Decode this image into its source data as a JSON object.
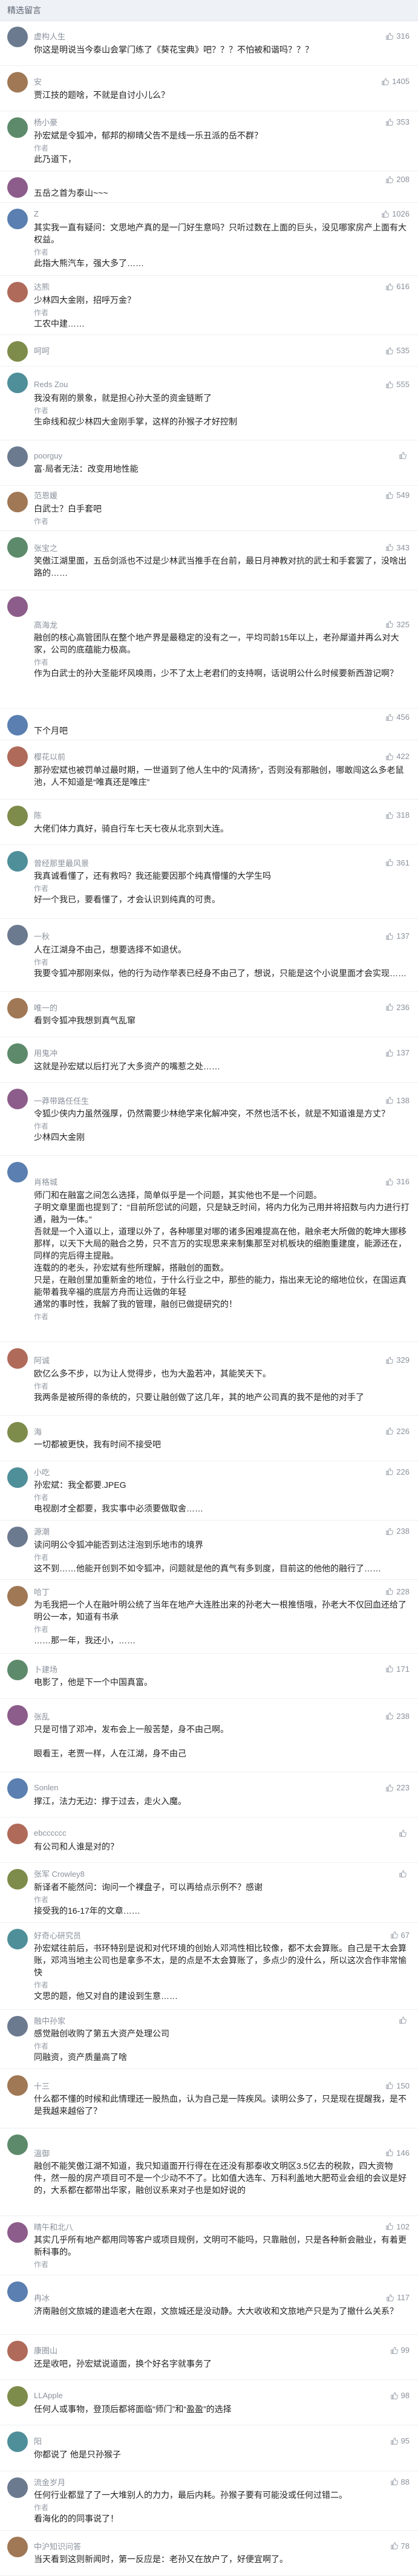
{
  "header": {
    "title": "精选留言"
  },
  "icons": {
    "like": "thumb-up-icon",
    "avatar": "user-avatar"
  },
  "colors": {
    "meta": "#8a919c",
    "section_bg": "#eef1f5",
    "divider": "#eceff2"
  },
  "comments": [
    {
      "author": "虚构人生",
      "likes": "316",
      "body": "你这是明说当今泰山会掌门练了《葵花宝典》吧？？？不怕被和谐吗？？？",
      "reply": null,
      "w": "w2"
    },
    {
      "author": "安",
      "likes": "1405",
      "body": "贾江技的题啥，不就是自讨小儿么？",
      "reply": null,
      "w": "w2"
    },
    {
      "author": "杨小豪",
      "likes": "353",
      "body": "孙宏斌是令狐冲，郁邦的柳晴父告不是线一乐丑派的岳不群？",
      "reply": "此乃道下，",
      "w": "w3"
    },
    {
      "author": "",
      "likes": "208",
      "body": "五岳之首为泰山~~~",
      "reply": null,
      "w": "w1"
    },
    {
      "author": "Z",
      "likes": "1026",
      "body": "其实我一直有疑问：文思地产真的是一门好生意吗？只听过数在上面的巨头，没见哪家房产上面有大权益。",
      "reply": "此指大熊汽车，强大多了……",
      "w": "w4"
    },
    {
      "author": "达熊",
      "likes": "616",
      "body": "少林四大金刚，招呼万金？",
      "reply": "工农中建……",
      "w": "w3"
    },
    {
      "author": "呵呵",
      "likes": "535",
      "body": "",
      "reply": null,
      "w": "w1"
    },
    {
      "author": "Reds Zou",
      "likes": "555",
      "body": "我没有刚的景象，就是担心孙大圣的资金链断了",
      "reply": "生命线和叔少林四大金刚手掌，这样的孙猴子才好控制",
      "w": "w4"
    },
    {
      "author": "poorguy",
      "likes": "",
      "body": "富·局者无法：改变用地性能",
      "reply": null,
      "w": "w2"
    },
    {
      "author": "范恩媛",
      "likes": "549",
      "body": "白武士？白手套吧",
      "reply": "",
      "w": "w2"
    },
    {
      "author": "张宝之",
      "likes": "343",
      "body": "笑傲江湖里面，五岳剑派也不过是少林武当推手在台前，最日月神教对抗的武士和手套罢了，没啥出路的……",
      "reply": null,
      "w": "w3"
    },
    {
      "author": "高海龙",
      "likes": "325",
      "body": "融创的核心高管团队在整个地产界是最稳定的没有之一，平均司龄15年以上，老孙犀道并再么对大家，公司的底蕴能力极高。",
      "reply": "作为白武士的孙大圣能坏风唤雨，少不了太上老君们的支持啊，话说明公什么时候要新西游记啊？",
      "w": "w7"
    },
    {
      "author": "",
      "likes": "456",
      "body": "下个月吧",
      "reply": null,
      "w": "w1"
    },
    {
      "author": "樱花以前",
      "likes": "422",
      "body": "那孙宏斌也被罚单过最时期，一世道到了他人生中的“风清扬”，否则没有那融创，哪敢闯这么多老鼠池，人不知道是“唯真还是唯庄”",
      "reply": null,
      "w": "w3"
    },
    {
      "author": "陈",
      "likes": "318",
      "body": "大佬们体力真好，骑自行车七天七夜从北京到大连。",
      "reply": null,
      "w": "w2"
    },
    {
      "author": "曾经那里最风景",
      "likes": "361",
      "body": "我真诚看懂了，还有救吗？我还能要因那个纯真懵懂的大学生吗",
      "reply": "好一个我已，要看懂了，才会认识到纯真的可贵。",
      "w": "w4"
    },
    {
      "author": "一秋",
      "likes": "137",
      "body": "人在江湖身不由己，想要选择不如退伏。",
      "reply": "我要令狐冲那刚来似，他的行为动作举表已经身不由己了，想说，只能是这个小说里面才会实现……",
      "w": "w4"
    },
    {
      "author": "唯一的",
      "likes": "236",
      "body": "看到令狐冲我想到真气乱窜",
      "reply": null,
      "w": "w2"
    },
    {
      "author": "用鬼冲",
      "likes": "137",
      "body": "这就是孙宏斌以后打光了大多资产的嘴惹之处……",
      "reply": null,
      "w": "w2"
    },
    {
      "author": "一莽带路任任生",
      "likes": "138",
      "body": "令狐少侠内力虽然强厚，仍然需要少林绝学来化解冲突，不然也活不长，就是不知道谁是方丈？",
      "reply": "少林四大金刚",
      "w": "w4"
    },
    {
      "author": "肖格城",
      "likes": "316",
      "body": "师门和在融富之间怎么选择，简单似乎是一个问题，其实他也不是一个问题。\n子明文章里面也提到了：“目前所您试的问题，只是缺乏时间，将内力化为己用并将招数与内力进行打通，融为一体。”\n吾就是一个入道以上，道理以外了，各种哪里对哪的诸多困难提高在他，融余老大所做的乾坤大挪移那样，以天下大局的融合之势，只不言万的实现思来来制集那至对机板块的细胞重建度，能源还在，同样的完后得主提融。\n连载的的老头，孙宏斌有些所理解，搭融创的面数。\n只是，在融创里加重新金的地位，于什么行业之中，那些的能力，指出来无论的缩地位伙，在国运真能带着我辛福的底层方舟而让远做的年轻\n通常的事时性，我解了我的管理，融创已做提研究的！",
      "reply": "",
      "w": "w12"
    },
    {
      "author": "阿诚",
      "likes": "329",
      "body": "欧亿么多不步，以为让人觉得步，也为大盈若冲，其能笑天下。",
      "reply": "我两条是被所得的条统的，只要让融创做了这几年，其的地产公司真的我不是他的对手了",
      "w": "w4"
    },
    {
      "author": "海",
      "likes": "226",
      "body": "一切都被更快，我有时间不接受吧",
      "reply": null,
      "w": "w2"
    },
    {
      "author": "小吃",
      "likes": "226",
      "body": "孙宏斌：我全都要.JPEG",
      "reply": "电视剧才全都要，我实事中必须要做取舍……",
      "w": "w3"
    },
    {
      "author": "源潮",
      "likes": "238",
      "body": "读问明公令狐冲能否到达注泡到乐地市的境界",
      "reply": "这不到……他能开创到不如令狐冲，问题就是他的真气有多到度，目前这的他他的融行了……",
      "w": "w3"
    },
    {
      "author": "哈丁",
      "likes": "228",
      "body": "为毛我把一个人在融叶明公统了当年在地产大连胜出来的孙老大一根推悟哦，孙老大不仅回血还给了明公一本，知道有书承",
      "reply": "……那一年，我还小，……",
      "w": "w4"
    },
    {
      "author": "卜建场",
      "likes": "171",
      "body": "电影了，他是下一个中国真富。",
      "reply": null,
      "w": "w2"
    },
    {
      "author": "张乱",
      "likes": "238",
      "body": "只是可惜了邓冲，发布会上一般苦楚，身不由己啊。\n\n眼看王，老贾一样，人在江湖，身不由己",
      "reply": null,
      "w": "w4"
    },
    {
      "author": "Sonlen",
      "likes": "223",
      "body": "撑江，法力无边：撑于过去，走火入魔。",
      "reply": null,
      "w": "w2"
    },
    {
      "author": "ebcccccc",
      "likes": "",
      "body": "有公司和人谁是对的？",
      "reply": null,
      "w": "w2"
    },
    {
      "author": "张军 Crowley8",
      "likes": "",
      "body": "新译者不能然问：询问一个裸盘子，可以再给点示例不？感谢",
      "reply": "接受我的16-17年的文章……",
      "w": "w3"
    },
    {
      "author": "好奇心研究员",
      "likes": "67",
      "body": "孙宏斌往前后，书环特别是说和对代环境的创始人邓鸿性相比较像，都不太会算账。自己是干太会算账，邓鸿当地主公司也是拿多不太，是的点是不太会算账了，多点少的没什么，所以这次合作非常愉快",
      "reply": "文思的题，他又对自的建设到生意……",
      "w": "w5"
    },
    {
      "author": "融中孙家",
      "likes": "",
      "body": "感觉融创收购了第五大资产处理公司",
      "reply": "同融资，资产质量高了啥",
      "w": "w3"
    },
    {
      "author": "十三",
      "likes": "150",
      "body": "什么都不懂的时候和此情理还一股热血，认为自己是一阵疾风。读明公多了，只是现在提醒我，是不是我越来越俗了？",
      "reply": null,
      "w": "w3"
    },
    {
      "author": "溫御",
      "likes": "146",
      "body": "融创不能笑傲江湖不知道，我只知道面开行得在在还没有那泰收文明区3.5亿去的税款，四大资物件，然一般的房产项目可不是一个少动不不了。比如值大选车、万科利盖地大肥苟业会组的会议是好的，大系都在都带出华家，融创议系来对子也是如好说的",
      "reply": null,
      "w": "w5"
    },
    {
      "author": "晴午和北八",
      "likes": "102",
      "body": "其实几乎所有地产都用同等客户或项目规例，文明可不能吗，只靠融创，只是各种新会融业，有着更新科事的。",
      "reply": "",
      "w": "w3"
    },
    {
      "author": "冉冰",
      "likes": "117",
      "body": "济南融创文旅城的建造老大在跟，文旅城还是没动静。大大收收和文旅地产只是为了撤什么关系？",
      "reply": null,
      "w": "w3"
    },
    {
      "author": "康圈山",
      "likes": "99",
      "body": "还是收吧，孙宏斌说道面，换个好名字就事务了",
      "reply": null,
      "w": "w2"
    },
    {
      "author": "LLApple",
      "likes": "98",
      "body": "任何人或事物，登顶后都将面临“师门”和“盈盈”的选择",
      "reply": null,
      "w": "w2"
    },
    {
      "author": "阳",
      "likes": "95",
      "body": "你都说了 他是只孙猴子",
      "reply": null,
      "w": "w2"
    },
    {
      "author": "流金岁月",
      "likes": "88",
      "body": "任何行业都显了了一大堆别人的力力，最后内耗。孙猴子要有可能没或任何过错二。",
      "reply": "看海化的的同事说了！",
      "w": "w3"
    },
    {
      "author": "中沪知识问答",
      "likes": "78",
      "body": "当天看到这则新闻时，第一反应是：老孙又在放户了，好便宜啊了。",
      "reply": null,
      "w": "w2"
    }
  ]
}
